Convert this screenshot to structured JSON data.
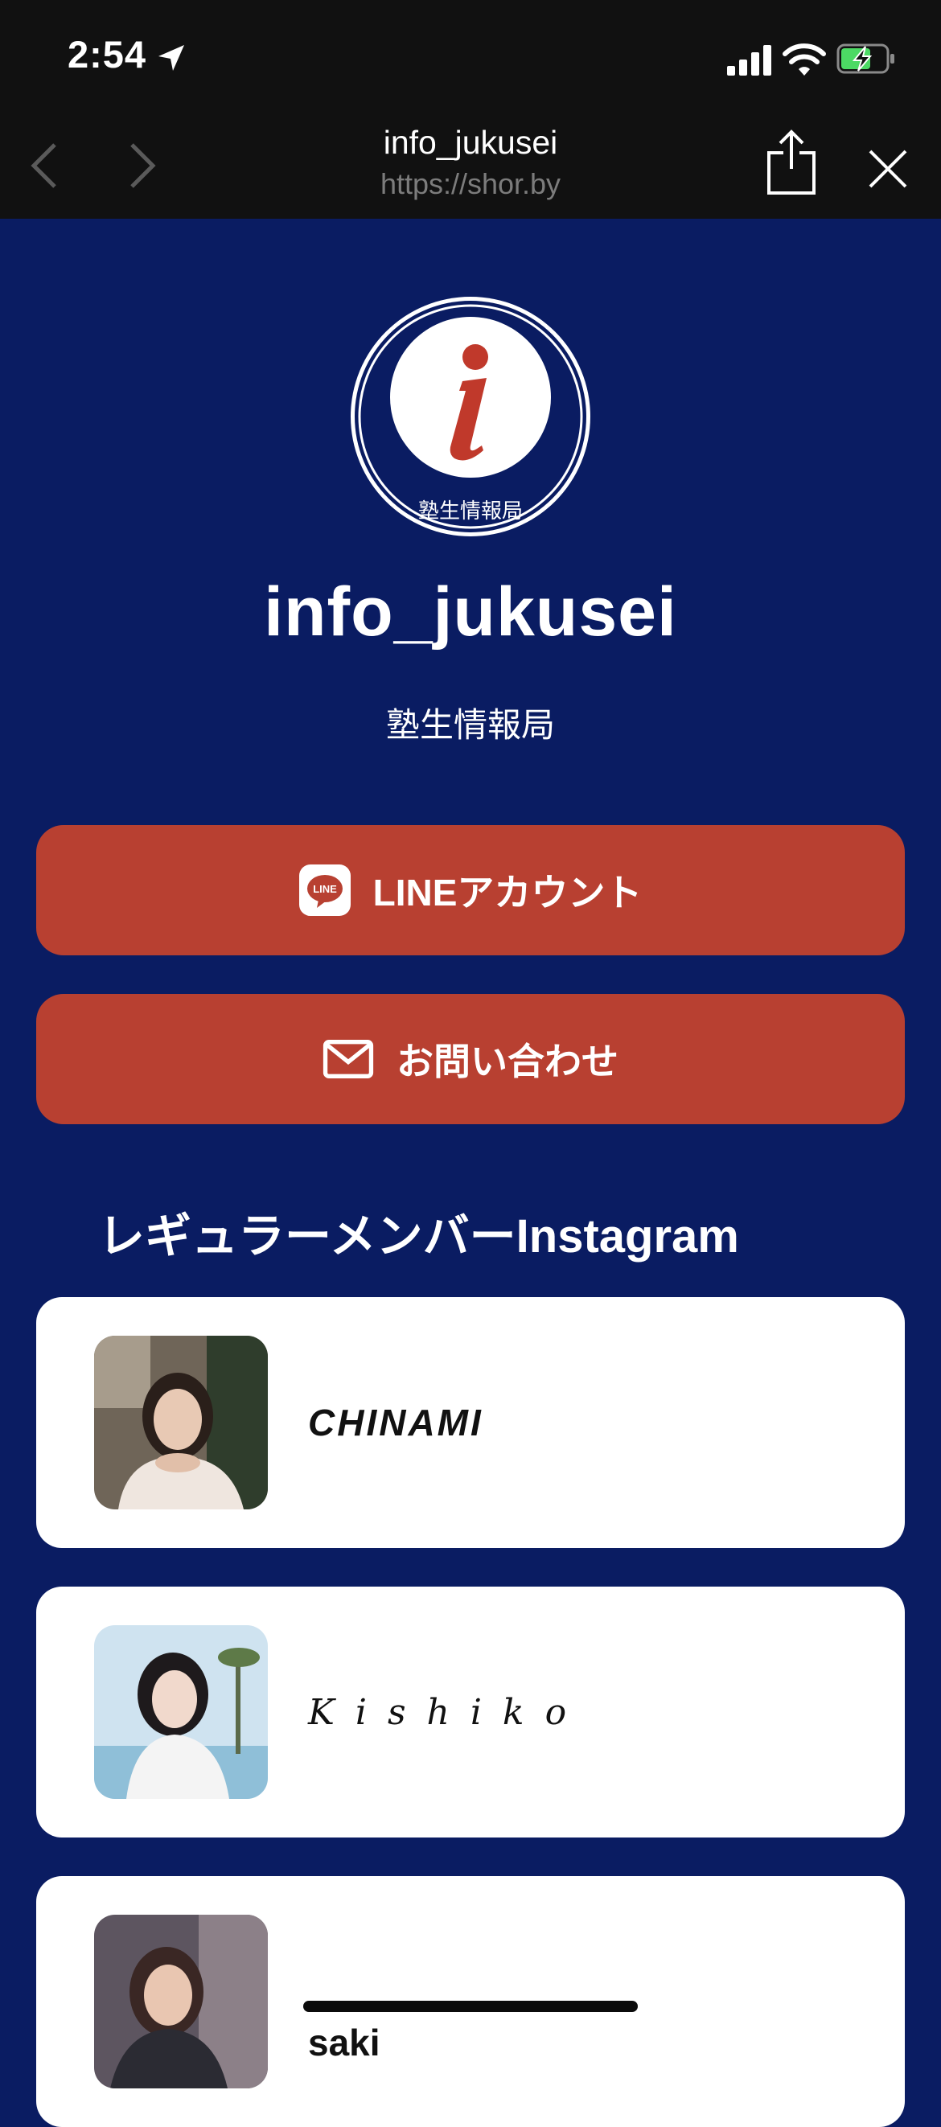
{
  "status_bar": {
    "time": "2:54",
    "icons": [
      "location-arrow-icon",
      "cellular-signal-icon",
      "wifi-icon",
      "battery-charging-icon"
    ]
  },
  "browser": {
    "title": "info_jukusei",
    "url": "https://shor.by",
    "icons": [
      "back-chevron-icon",
      "forward-chevron-icon",
      "share-icon",
      "close-icon"
    ]
  },
  "profile": {
    "logo_text": "塾生情報局",
    "name": "info_jukusei",
    "subtitle": "塾生情報局"
  },
  "buttons": {
    "line_label": "LINEアカウント",
    "line_icon_text": "LINE",
    "contact_label": "お問い合わせ"
  },
  "section": {
    "title": "レギュラーメンバーInstagram"
  },
  "members": [
    {
      "name": "CHINAMI"
    },
    {
      "name": "Kishiko"
    },
    {
      "name": "saki"
    }
  ],
  "colors": {
    "background": "#0a1c62",
    "button": "#b84031",
    "card": "#ffffff",
    "bar": "#111111"
  }
}
